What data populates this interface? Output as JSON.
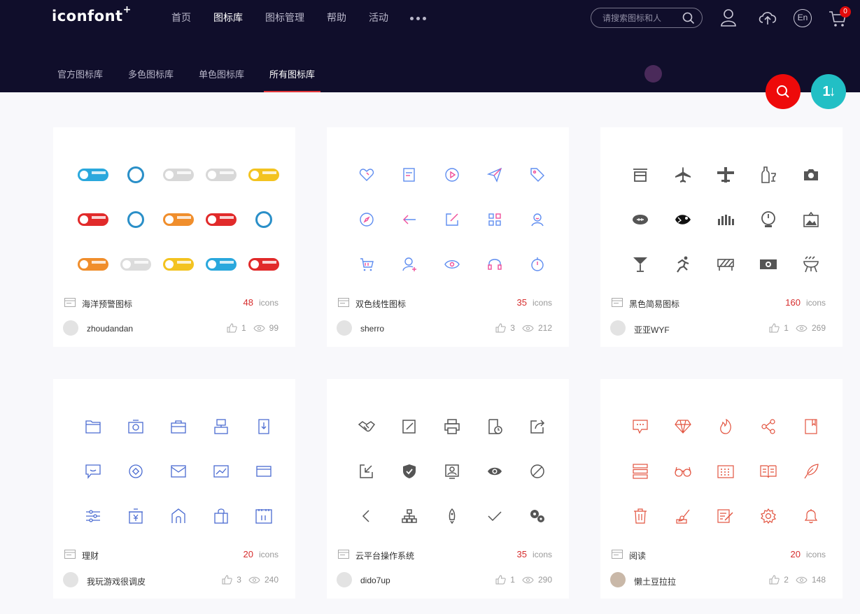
{
  "header": {
    "logo_text": "iconfont",
    "logo_sup": "+",
    "nav": [
      "首页",
      "图标库",
      "图标管理",
      "帮助",
      "活动"
    ],
    "nav_active": 1,
    "search_placeholder": "请搜索图标和人",
    "user_icon": "user-icon",
    "upload_icon": "cloud-upload-icon",
    "lang_label": "En",
    "cart_icon": "cart-icon",
    "cart_count": "0"
  },
  "subnav": {
    "items": [
      "官方图标库",
      "多色图标库",
      "单色图标库",
      "所有图标库"
    ],
    "active": 3
  },
  "fab": {
    "sort_label": "1↓"
  },
  "colors": {
    "header_bg": "#100e2b",
    "accent_red": "#e4393c",
    "fab_red": "#ee0a0a",
    "fab_cyan": "#22bfc5"
  },
  "cards": [
    {
      "title": "海洋预警图标",
      "count": "48",
      "unit": "icons",
      "author": "zhoudandan",
      "likes": "1",
      "views": "99",
      "icon_style": "colorful-warning"
    },
    {
      "title": "双色线性图标",
      "count": "35",
      "unit": "icons",
      "author": "sherro",
      "likes": "3",
      "views": "212",
      "icon_style": "two-tone-line",
      "icon_color": "#5f8df0"
    },
    {
      "title": "黑色简易图标",
      "count": "160",
      "unit": "icons",
      "author": "亚亚WYF",
      "likes": "1",
      "views": "269",
      "icon_style": "solid-black",
      "icon_color": "#555555"
    },
    {
      "title": "理财",
      "count": "20",
      "unit": "icons",
      "author": "我玩游戏很调皮",
      "likes": "3",
      "views": "240",
      "icon_style": "blue-line",
      "icon_color": "#4a6bd1"
    },
    {
      "title": "云平台操作系统",
      "count": "35",
      "unit": "icons",
      "author": "dido7up",
      "likes": "1",
      "views": "290",
      "icon_style": "gray-line",
      "icon_color": "#555555"
    },
    {
      "title": "阅读",
      "count": "20",
      "unit": "icons",
      "author": "懒土豆拉拉",
      "likes": "2",
      "views": "148",
      "icon_style": "red-line",
      "icon_color": "#e2533f"
    }
  ]
}
